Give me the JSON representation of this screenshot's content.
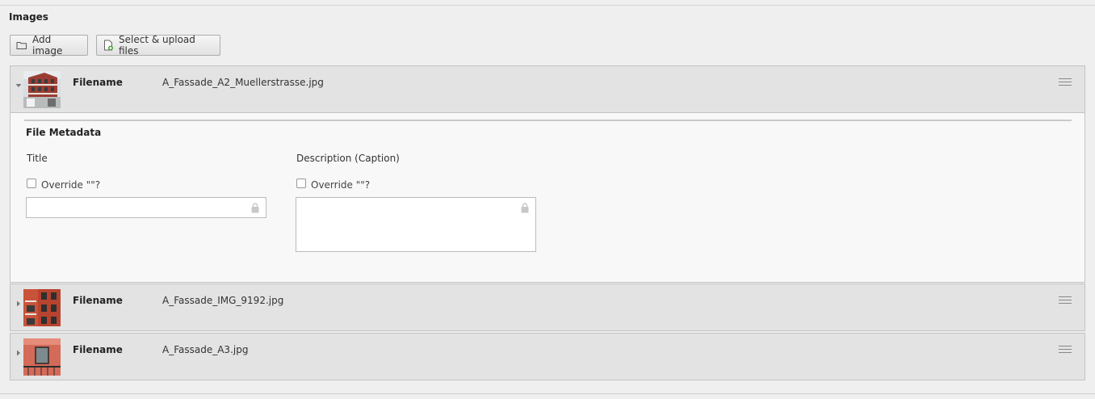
{
  "section": {
    "title": "Images"
  },
  "toolbar": {
    "add_image_label": "Add image",
    "upload_label": "Select & upload files",
    "add_image_icon": "folder-icon",
    "upload_icon": "file-upload-icon"
  },
  "records": [
    {
      "label": "Filename",
      "filename": "A_Fassade_A2_Muellerstrasse.jpg",
      "expanded": true,
      "metadata": {
        "title": "File Metadata",
        "fields": [
          {
            "label": "Title",
            "override_label": "Override \"\"?",
            "value": "",
            "checked": false
          },
          {
            "label": "Description (Caption)",
            "override_label": "Override \"\"?",
            "value": "",
            "checked": false
          }
        ]
      }
    },
    {
      "label": "Filename",
      "filename": "A_Fassade_IMG_9192.jpg",
      "expanded": false
    },
    {
      "label": "Filename",
      "filename": "A_Fassade_A3.jpg",
      "expanded": false
    }
  ],
  "colors": {
    "header_bg": "#e3e3e3",
    "panel_bg": "#f8f8f8",
    "page_bg": "#efefef"
  }
}
